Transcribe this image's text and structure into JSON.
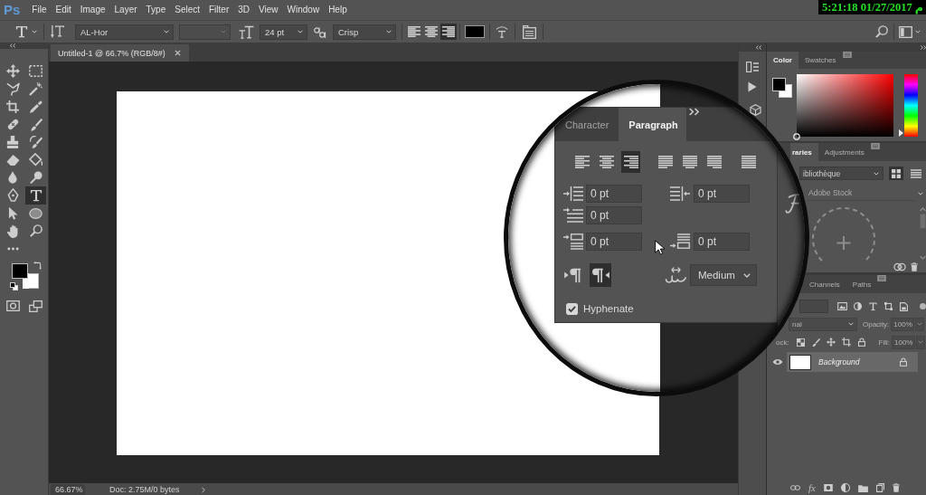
{
  "menu_bar": {
    "logo": "Ps",
    "items": [
      "File",
      "Edit",
      "Image",
      "Layer",
      "Type",
      "Select",
      "Filter",
      "3D",
      "View",
      "Window",
      "Help"
    ]
  },
  "timestamp": "5:21:18 01/27/2017 م",
  "options_bar": {
    "font_family": "AL-Hor",
    "font_style": {
      "disabled": true
    },
    "font_size": "24 pt",
    "anti_alias": "Crisp",
    "alignment": [
      {
        "kind": "left",
        "selected": false
      },
      {
        "kind": "center",
        "selected": false
      },
      {
        "kind": "right",
        "selected": true
      }
    ],
    "text_color": {
      "color": "#000000"
    }
  },
  "tools": [
    {
      "kind": "move",
      "selected": false
    },
    {
      "kind": "marquee",
      "selected": false
    },
    {
      "kind": "lasso",
      "selected": false
    },
    {
      "kind": "magic_wand",
      "selected": false
    },
    {
      "kind": "crop",
      "selected": false
    },
    {
      "kind": "eyedropper",
      "selected": false
    },
    {
      "kind": "healing",
      "selected": false
    },
    {
      "kind": "brush",
      "selected": false
    },
    {
      "kind": "stamp",
      "selected": false
    },
    {
      "kind": "history_brush",
      "selected": false
    },
    {
      "kind": "eraser",
      "selected": false
    },
    {
      "kind": "paint_bucket",
      "selected": false
    },
    {
      "kind": "blur",
      "selected": false
    },
    {
      "kind": "dodge",
      "selected": false
    },
    {
      "kind": "pen",
      "selected": false
    },
    {
      "kind": "type",
      "selected": true
    },
    {
      "kind": "path_selection",
      "selected": false
    },
    {
      "kind": "ellipse",
      "selected": false
    },
    {
      "kind": "hand",
      "selected": false
    },
    {
      "kind": "zoom",
      "selected": false
    },
    {
      "kind": "more",
      "selected": false
    }
  ],
  "tool_colors": [
    {
      "kind": "foreground",
      "color": "#000000"
    },
    {
      "kind": "background",
      "color": "#ffffff"
    }
  ],
  "view_tools": [
    {
      "kind": "quick_mask",
      "selected": false
    },
    {
      "kind": "screen_mode",
      "selected": false
    }
  ],
  "document": {
    "tab_title": "Untitled-1 @ 66.7% (RGB/8#)"
  },
  "status_bar": {
    "zoom": "66.67%",
    "doc_info": "Doc: 2.75M/0 bytes"
  },
  "color_panel": {
    "tabs": [
      {
        "label": "Color",
        "selected": true
      },
      {
        "label": "Swatches",
        "selected": false
      }
    ],
    "swatches": [
      {
        "kind": "foreground",
        "color": "#000000"
      },
      {
        "kind": "background",
        "color": "#ffffff"
      }
    ],
    "hue": {
      "level": 0
    }
  },
  "libraries_panel": {
    "tabs": [
      {
        "label": "raries",
        "selected": true
      },
      {
        "label": "Adjustments",
        "selected": false
      }
    ],
    "library": "ibliothèque",
    "views": [
      {
        "kind": "grid",
        "selected": true
      },
      {
        "kind": "list",
        "selected": false
      }
    ],
    "search": {
      "placeholder": "Adobe Stock"
    }
  },
  "layers_panel": {
    "tabs": [
      {
        "label": "Channels",
        "selected": false
      },
      {
        "label": "Paths",
        "selected": false
      }
    ],
    "blend_mode": {
      "value": "nal",
      "disabled": true
    },
    "opacity": {
      "label": "Opacity:",
      "value": "100%",
      "disabled": true
    },
    "lock_label": "ock:",
    "fill": {
      "label": "Fill:",
      "value": "100%",
      "disabled": true
    },
    "layers": [
      {
        "name": "Background",
        "visible": true,
        "selected": true,
        "locked": true
      }
    ],
    "fx": "fx"
  },
  "paragraph_panel": {
    "tabs": [
      {
        "label": "Character",
        "selected": false
      },
      {
        "label": "Paragraph",
        "selected": true
      }
    ],
    "alignment": [
      {
        "kind": "left",
        "selected": false
      },
      {
        "kind": "center",
        "selected": false
      },
      {
        "kind": "right",
        "selected": true
      },
      {
        "kind": "justify_left",
        "selected": false
      },
      {
        "kind": "justify_center",
        "selected": false
      },
      {
        "kind": "justify_right",
        "selected": false
      },
      {
        "kind": "justify_all",
        "selected": false
      }
    ],
    "spacing": [
      {
        "kind": "indent_left",
        "value": "0 pt"
      },
      {
        "kind": "indent_right",
        "value": "0 pt"
      },
      {
        "kind": "indent_first",
        "value": "0 pt"
      },
      {
        "kind": "space_before",
        "value": "0 pt"
      },
      {
        "kind": "space_after",
        "value": "0 pt"
      }
    ],
    "direction": [
      {
        "kind": "ltr",
        "selected": false
      },
      {
        "kind": "rtl",
        "selected": true
      }
    ],
    "kashida": "Medium",
    "hyphenate": {
      "label": "Hyphenate",
      "checked": true
    }
  }
}
